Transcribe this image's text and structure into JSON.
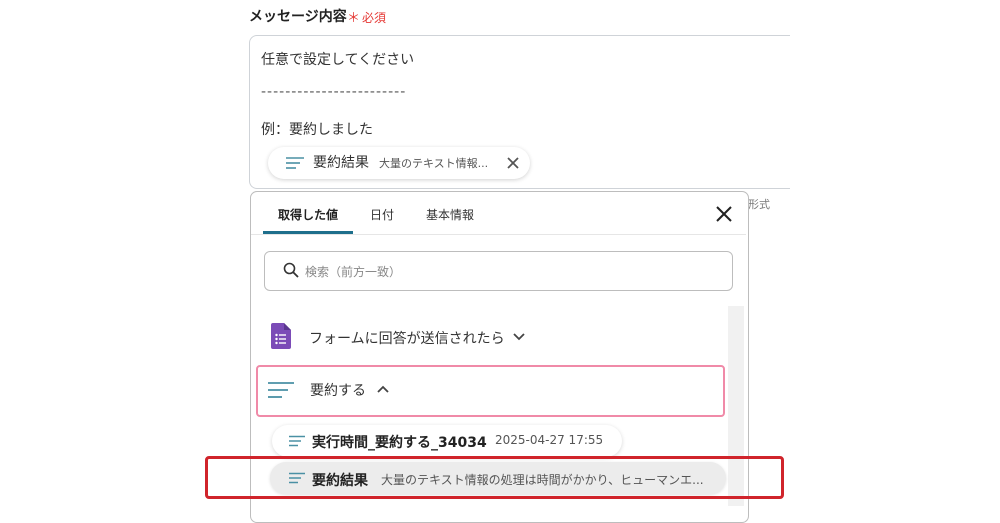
{
  "field": {
    "label": "メッセージ内容",
    "required_mark": "＊",
    "required_text": "必須"
  },
  "message": {
    "line1": "任意で設定してください",
    "line2": "------------------------",
    "line3": "例：要約しました"
  },
  "chip": {
    "title": "要約結果",
    "subtitle": "大量のテキスト情報..."
  },
  "helper_text": "形式",
  "panel": {
    "tabs": [
      {
        "label": "取得した値",
        "active": true
      },
      {
        "label": "日付",
        "active": false
      },
      {
        "label": "基本情報",
        "active": false
      }
    ],
    "search_placeholder": "検索（前方一致）",
    "groups": [
      {
        "label": "フォームに回答が送信されたら",
        "icon": "google-forms-icon",
        "expanded": false
      },
      {
        "label": "要約する",
        "icon": "text-lines-icon",
        "expanded": true
      }
    ],
    "items": [
      {
        "title": "実行時間_要約する_34034",
        "value": "2025-04-27 17:55"
      },
      {
        "title": "要約結果",
        "value": "大量のテキスト情報の処理は時間がかかり、ヒューマンエ..."
      }
    ]
  },
  "colors": {
    "accent_tab": "#1e6f8c",
    "required": "#e53935",
    "selected_border": "#f08aa8",
    "highlight_red": "#d0242b",
    "forms_purple": "#7b4bb7",
    "lines_icon": "#4a90a4"
  }
}
